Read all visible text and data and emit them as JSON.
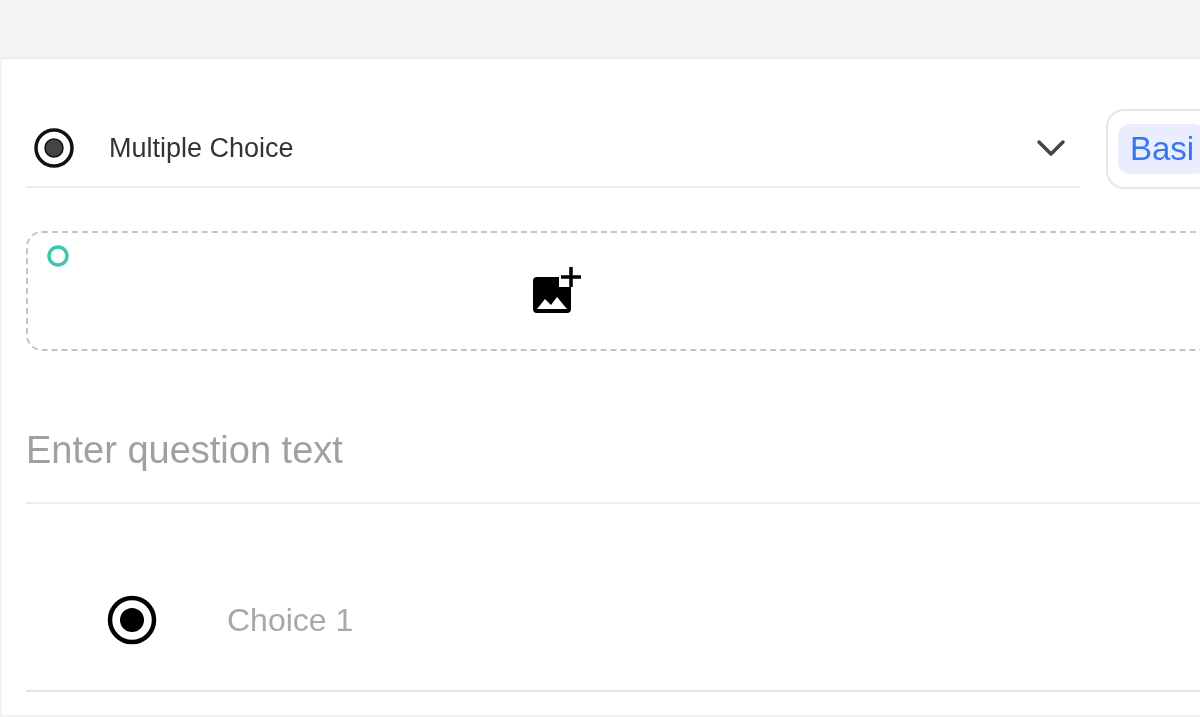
{
  "question_type": {
    "label": "Multiple Choice"
  },
  "mode_tabs": [
    {
      "label": "Basi",
      "selected": true
    }
  ],
  "question": {
    "placeholder": "Enter question text"
  },
  "choices": [
    {
      "placeholder": "Choice 1",
      "selected": true
    }
  ]
}
